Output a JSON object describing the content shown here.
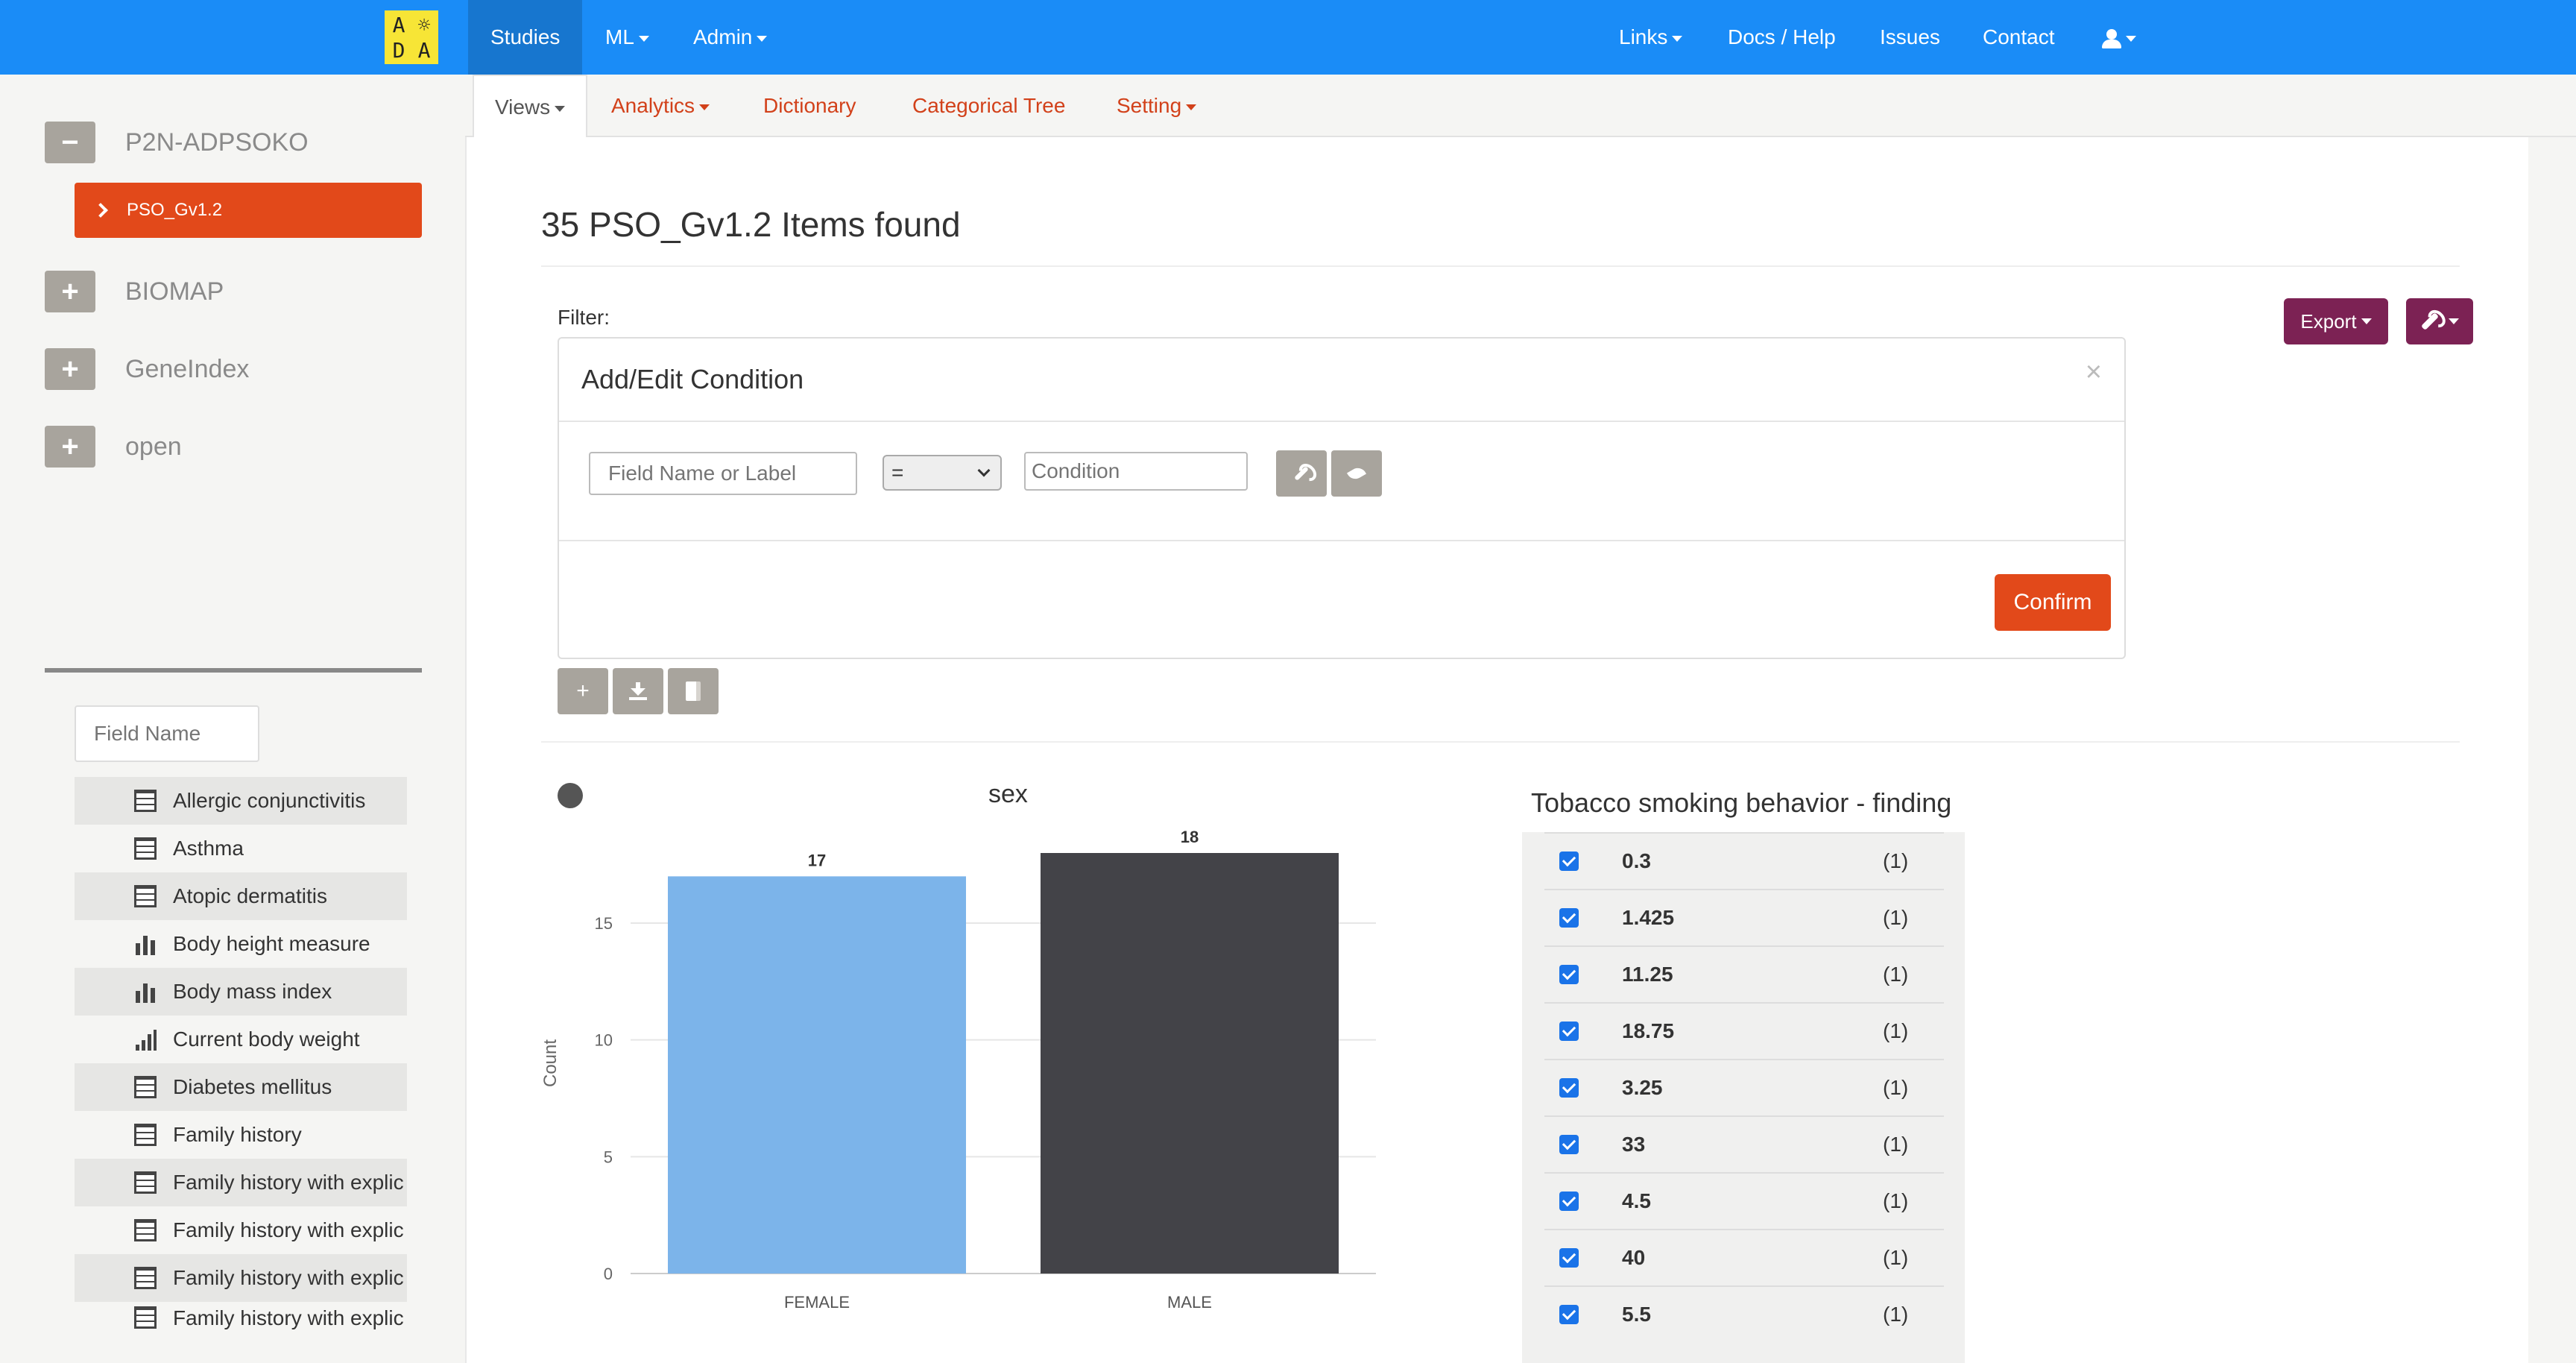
{
  "logo": {
    "letters": [
      "A",
      "☼",
      "D",
      "A"
    ]
  },
  "nav": {
    "left": [
      {
        "label": "Studies",
        "active": true
      },
      {
        "label": "ML",
        "caret": true
      },
      {
        "label": "Admin",
        "caret": true
      }
    ],
    "right": [
      {
        "label": "Links",
        "caret": true
      },
      {
        "label": "Docs / Help"
      },
      {
        "label": "Issues"
      },
      {
        "label": "Contact"
      }
    ],
    "user_icon": "user-icon"
  },
  "sidebar": {
    "studies": [
      {
        "toggle": "−",
        "label": "P2N-ADPSOKO",
        "expanded": true
      },
      {
        "toggle": "+",
        "label": "BIOMAP"
      },
      {
        "toggle": "+",
        "label": "GeneIndex"
      },
      {
        "toggle": "+",
        "label": "open"
      }
    ],
    "active_dataset": "PSO_Gv1.2",
    "field_filter_placeholder": "Field Name",
    "fields": [
      {
        "label": "Allergic conjunctivitis",
        "icon": "table-icon"
      },
      {
        "label": "Asthma",
        "icon": "table-icon"
      },
      {
        "label": "Atopic dermatitis",
        "icon": "table-icon"
      },
      {
        "label": "Body height measure",
        "icon": "bar-chart-icon"
      },
      {
        "label": "Body mass index",
        "icon": "bar-chart-icon"
      },
      {
        "label": "Current body weight",
        "icon": "signal-icon"
      },
      {
        "label": "Diabetes mellitus",
        "icon": "table-icon"
      },
      {
        "label": "Family history",
        "icon": "table-icon"
      },
      {
        "label": "Family history with explic",
        "icon": "table-icon"
      },
      {
        "label": "Family history with explic",
        "icon": "table-icon"
      },
      {
        "label": "Family history with explic",
        "icon": "table-icon"
      },
      {
        "label": "Family history with explic",
        "icon": "table-icon"
      }
    ]
  },
  "subnav": [
    {
      "label": "Views",
      "active": true,
      "caret": true
    },
    {
      "label": "Analytics",
      "caret": true
    },
    {
      "label": "Dictionary"
    },
    {
      "label": "Categorical Tree"
    },
    {
      "label": "Setting",
      "caret": true
    }
  ],
  "main": {
    "title": "35 PSO_Gv1.2 Items found",
    "filter_label": "Filter:",
    "export_label": "Export",
    "panel": {
      "title": "Add/Edit Condition",
      "close": "×",
      "field_placeholder": "Field Name or Label",
      "operator": "=",
      "condition_placeholder": "Condition",
      "confirm_label": "Confirm"
    }
  },
  "chart_data": {
    "type": "bar",
    "title": "sex",
    "categories": [
      "FEMALE",
      "MALE"
    ],
    "values": [
      17,
      18
    ],
    "colors": [
      "#7cb4ea",
      "#434348"
    ],
    "ylabel": "Count",
    "xlabel": "",
    "ylim": [
      0,
      18
    ],
    "yticks": [
      0,
      5,
      10,
      15
    ],
    "grid": true
  },
  "tobacco": {
    "title": "Tobacco smoking behavior - finding",
    "rows": [
      {
        "value": "0.3",
        "count": "(1)"
      },
      {
        "value": "1.425",
        "count": "(1)"
      },
      {
        "value": "11.25",
        "count": "(1)"
      },
      {
        "value": "18.75",
        "count": "(1)"
      },
      {
        "value": "3.25",
        "count": "(1)"
      },
      {
        "value": "33",
        "count": "(1)"
      },
      {
        "value": "4.5",
        "count": "(1)"
      },
      {
        "value": "40",
        "count": "(1)"
      },
      {
        "value": "5.5",
        "count": "(1)"
      }
    ]
  },
  "colors": {
    "navbar": "#1a8cf7",
    "accent": "#e2491a",
    "purple": "#7c2254",
    "grey_button": "#a8a49d"
  }
}
